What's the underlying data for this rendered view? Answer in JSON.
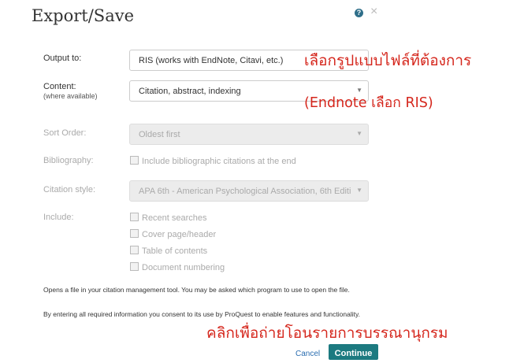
{
  "dialog": {
    "title": "Export/Save",
    "help_label": "?",
    "close_label": "×"
  },
  "form": {
    "output_to": {
      "label": "Output to:",
      "value": "RIS (works with EndNote, Citavi, etc.)"
    },
    "content": {
      "label": "Content:",
      "sublabel": "(where available)",
      "value": "Citation, abstract, indexing"
    },
    "sort_order": {
      "label": "Sort Order:",
      "value": "Oldest first"
    },
    "bibliography": {
      "label": "Bibliography:",
      "option": "Include bibliographic citations at the end"
    },
    "citation_style": {
      "label": "Citation style:",
      "value": "APA 6th - American Psychological Association, 6th Editi"
    },
    "include": {
      "label": "Include:",
      "options": [
        "Recent searches",
        "Cover page/header",
        "Table of contents",
        "Document numbering"
      ]
    }
  },
  "notes": {
    "line1": "Opens a file in your citation management tool. You may be asked which program to use to open the file.",
    "line2": "By entering all required information you consent to its use by ProQuest to enable features and functionality."
  },
  "buttons": {
    "cancel": "Cancel",
    "continue": "Continue"
  },
  "annotations": {
    "select_format": "เลือกรูปแบบไฟล์ที่ต้องการ",
    "endnote_hint": "(Endnote เลือก RIS)",
    "click_transfer": "คลิกเพื่อถ่ายโอนรายการบรรณานุกรม"
  }
}
